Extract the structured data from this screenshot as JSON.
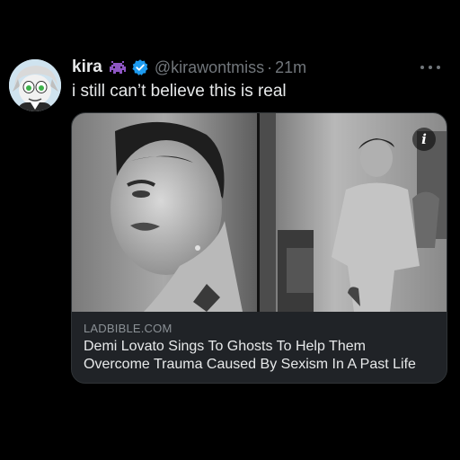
{
  "tweet": {
    "display_name": "kira",
    "name_emoji": "alien-monster",
    "verified": true,
    "handle": "@kirawontmiss",
    "separator": "·",
    "timestamp": "21m",
    "text": "i still can’t believe this is real"
  },
  "card": {
    "domain": "LADBIBLE.COM",
    "headline_line1": "Demi Lovato Sings To Ghosts To Help Them",
    "headline_line2": "Overcome Trauma Caused By Sexism In A Past Life",
    "info_glyph": "i"
  },
  "colors": {
    "background": "#000000",
    "primary_text": "#e7e9ea",
    "secondary_text": "#71767b",
    "verified_blue": "#1d9bf0",
    "emoji_purple": "#8e56c4",
    "card_bg": "#202327"
  }
}
